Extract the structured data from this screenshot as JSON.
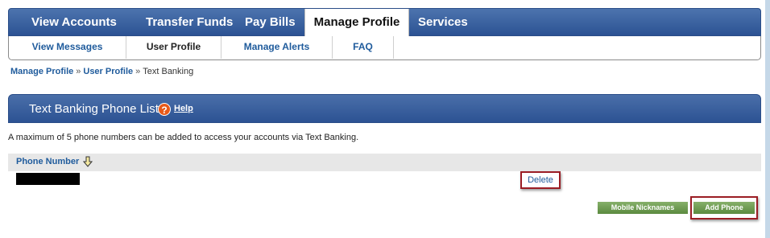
{
  "main_nav": {
    "tabs": [
      {
        "label": "View Accounts"
      },
      {
        "label": "Transfer Funds"
      },
      {
        "label": "Pay Bills"
      },
      {
        "label": "Manage Profile"
      },
      {
        "label": "Services"
      }
    ],
    "active": "Manage Profile"
  },
  "sub_nav": {
    "items": [
      {
        "label": "View Messages"
      },
      {
        "label": "User Profile"
      },
      {
        "label": "Manage Alerts"
      },
      {
        "label": "FAQ"
      }
    ],
    "current": "User Profile"
  },
  "breadcrumb": {
    "items": [
      "Manage Profile",
      "User Profile",
      "Text Banking"
    ],
    "separator": "»"
  },
  "section": {
    "title": "Text Banking Phone List",
    "help_icon": "?",
    "help_label": "Help"
  },
  "info_text": "A maximum of 5 phone numbers can be added to access your accounts via Text Banking.",
  "table": {
    "column_header": "Phone Number",
    "sort_icon": "sort-down-arrow-icon",
    "rows": [
      {
        "phone": "",
        "action": "Delete"
      }
    ]
  },
  "buttons": {
    "mobile_nicknames": "Mobile Nicknames",
    "add_phone": "Add Phone"
  },
  "colors": {
    "nav_blue": "#2c5293",
    "link_blue": "#1f5b9c",
    "button_green": "#6e9b50",
    "highlight_red": "#9b1d24"
  }
}
